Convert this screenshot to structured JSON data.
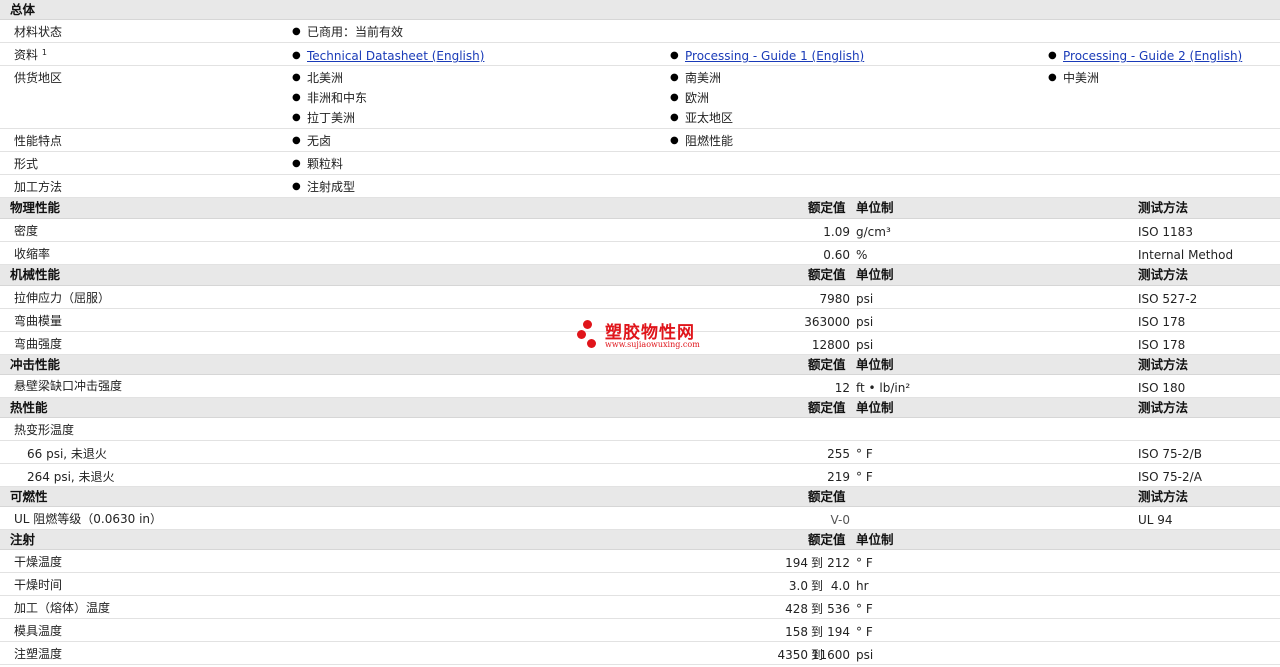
{
  "general": {
    "title": "总体",
    "status_label": "材料状态",
    "status_value": "已商用：当前有效",
    "docs_label": "资料",
    "docs_sup": "1",
    "docs": [
      "Technical Datasheet (English)",
      "Processing - Guide 1 (English)",
      "Processing - Guide 2 (English)"
    ],
    "region_label": "供货地区",
    "regions": [
      "北美洲",
      "南美洲",
      "中美洲",
      "非洲和中东",
      "欧洲",
      "拉丁美洲",
      "亚太地区"
    ],
    "features_label": "性能特点",
    "features": [
      "无卤",
      "阻燃性能"
    ],
    "form_label": "形式",
    "form": "颗粒料",
    "process_label": "加工方法",
    "process": "注射成型"
  },
  "headers": {
    "rated": "额定值",
    "unit": "单位制",
    "test": "测试方法"
  },
  "physical": {
    "title": "物理性能",
    "rows": [
      {
        "name": "密度",
        "value": "1.09",
        "unit": "g/cm³",
        "test": "ISO 1183"
      },
      {
        "name": "收缩率",
        "value": "0.60",
        "unit": "%",
        "test": "Internal Method"
      }
    ]
  },
  "mechanical": {
    "title": "机械性能",
    "rows": [
      {
        "name": "拉伸应力（屈服）",
        "value": "7980",
        "unit": "psi",
        "test": "ISO 527-2"
      },
      {
        "name": "弯曲模量",
        "value": "363000",
        "unit": "psi",
        "test": "ISO 178"
      },
      {
        "name": "弯曲强度",
        "value": "12800",
        "unit": "psi",
        "test": "ISO 178"
      }
    ]
  },
  "impact": {
    "title": "冲击性能",
    "rows": [
      {
        "name": "悬壁梁缺口冲击强度",
        "value": "12",
        "unit": "ft • lb/in²",
        "test": "ISO 180"
      }
    ]
  },
  "thermal": {
    "title": "热性能",
    "group": "热变形温度",
    "rows": [
      {
        "name": "66 psi, 未退火",
        "value": "255",
        "unit": "° F",
        "test": "ISO 75-2/B"
      },
      {
        "name": "264 psi, 未退火",
        "value": "219",
        "unit": "° F",
        "test": "ISO 75-2/A"
      }
    ]
  },
  "flammability": {
    "title": "可燃性",
    "rows": [
      {
        "name": "UL 阻燃等级（0.0630 in）",
        "value": "V-0",
        "test": "UL 94"
      }
    ]
  },
  "injection": {
    "title": "注射",
    "to": "到",
    "rows": [
      {
        "name": "干燥温度",
        "min": "194",
        "max": "212",
        "unit": "° F"
      },
      {
        "name": "干燥时间",
        "min": "3.0",
        "max": "4.0",
        "unit": "hr"
      },
      {
        "name": "加工（熔体）温度",
        "min": "428",
        "max": "536",
        "unit": "° F"
      },
      {
        "name": "模具温度",
        "min": "158",
        "max": "194",
        "unit": "° F"
      },
      {
        "name": "注塑温度",
        "min": "4350",
        "max": "11600",
        "unit": "psi"
      }
    ]
  },
  "watermark": {
    "title": "塑胶物性网",
    "url": "www.sujiaowuxing.com"
  },
  "colors": {
    "section_bg": "#e8e8e8",
    "link": "#1a3bb8",
    "watermark": "#e0151b"
  }
}
